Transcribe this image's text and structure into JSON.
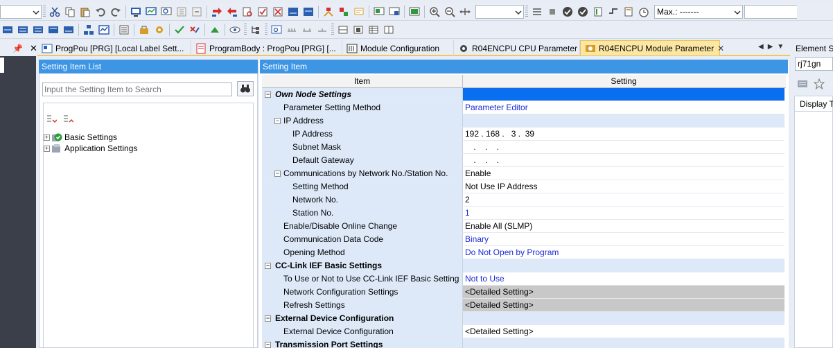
{
  "toolbar": {
    "max_label": "Max.: -------"
  },
  "doc_tabs": [
    {
      "label": "ProgPou [PRG] [Local Label Sett..."
    },
    {
      "label": "ProgramBody : ProgPou [PRG] [..."
    },
    {
      "label": "Module Configuration"
    },
    {
      "label": "R04ENCPU CPU Parameter"
    },
    {
      "label": "R04ENCPU Module Parameter"
    }
  ],
  "left_panel": {
    "title": "Setting Item List",
    "search_placeholder": "Input the Setting Item to Search",
    "tree": [
      {
        "label": "Basic Settings"
      },
      {
        "label": "Application Settings"
      }
    ]
  },
  "setting_panel": {
    "title": "Setting Item",
    "col_item": "Item",
    "col_setting": "Setting",
    "rows": [
      {
        "item": "Own Node Settings",
        "value": ""
      },
      {
        "item": "Parameter Setting Method",
        "value": "Parameter Editor"
      },
      {
        "item": "IP Address",
        "value": ""
      },
      {
        "item": "IP Address",
        "value": "192 . 168 .   3 .  39"
      },
      {
        "item": "Subnet Mask",
        "value": " .    .    ."
      },
      {
        "item": "Default Gateway",
        "value": " .    .    ."
      },
      {
        "item": "Communications by Network No./Station No.",
        "value": "Enable"
      },
      {
        "item": "Setting Method",
        "value": "Not Use IP Address"
      },
      {
        "item": "Network No.",
        "value": "2"
      },
      {
        "item": "Station No.",
        "value": "1"
      },
      {
        "item": "Enable/Disable Online Change",
        "value": "Enable All (SLMP)"
      },
      {
        "item": "Communication Data Code",
        "value": "Binary"
      },
      {
        "item": "Opening Method",
        "value": "Do Not Open by Program"
      },
      {
        "item": "CC-Link IEF Basic Settings",
        "value": ""
      },
      {
        "item": "To Use or Not to Use CC-Link IEF Basic Setting",
        "value": "Not to Use"
      },
      {
        "item": "Network Configuration Settings",
        "value": "<Detailed Setting>"
      },
      {
        "item": "Refresh Settings",
        "value": "<Detailed Setting>"
      },
      {
        "item": "External Device Configuration",
        "value": ""
      },
      {
        "item": "External Device Configuration",
        "value": "<Detailed Setting>"
      },
      {
        "item": "Transmission Port Settings",
        "value": ""
      }
    ]
  },
  "right_panel": {
    "title": "Element Se",
    "search_value": "rj71gn",
    "tab_label": "Display T"
  }
}
